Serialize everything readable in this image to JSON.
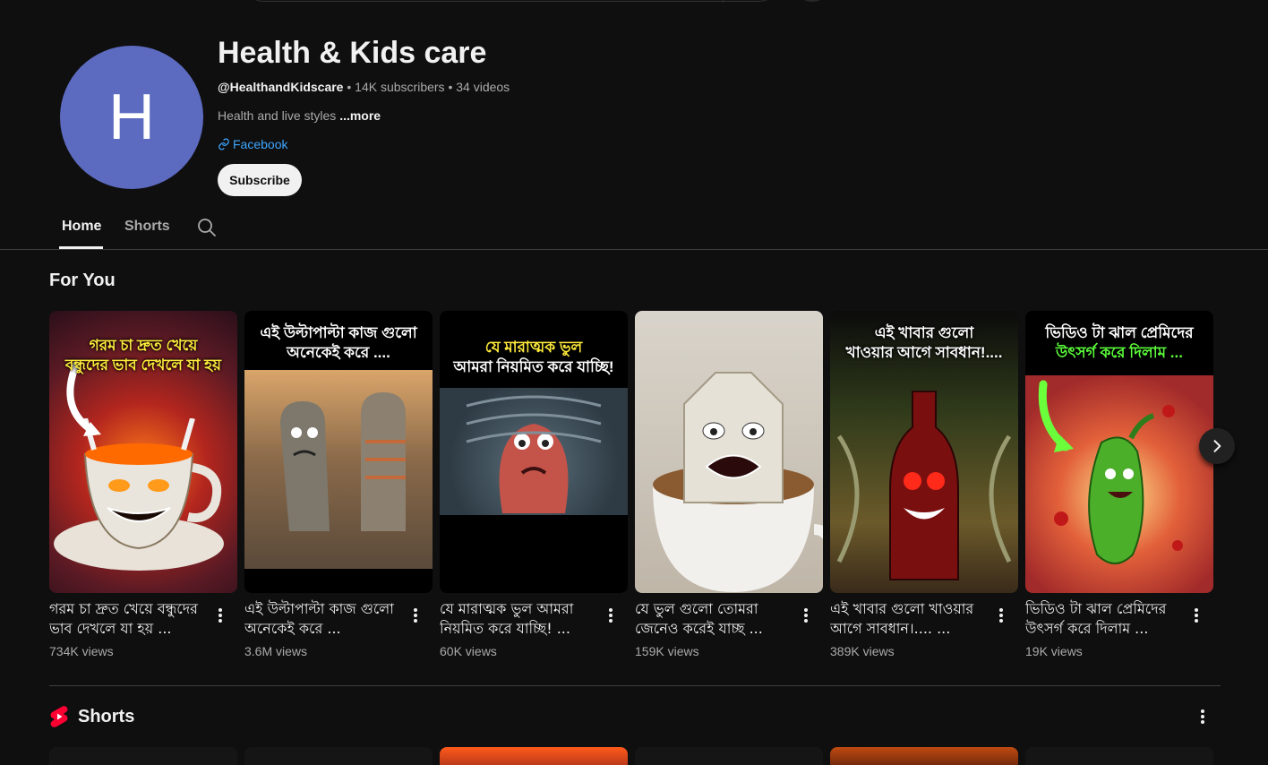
{
  "channel": {
    "avatar_letter": "H",
    "avatar_color": "#5c6bc0",
    "title": "Health & Kids care",
    "handle": "@HealthandKidscare",
    "meta_sep": " • ",
    "subscribers": "14K subscribers",
    "videos": "34 videos",
    "description": "Health and live styles ",
    "more": "...more",
    "link_icon": "link-icon",
    "link_label": "Facebook",
    "subscribe_label": "Subscribe"
  },
  "tabs": [
    {
      "label": "Home",
      "active": true
    },
    {
      "label": "Shorts",
      "active": false
    }
  ],
  "section_title": "For You",
  "videos": [
    {
      "caption_lines": [
        "গরম চা দ্রুত খেয়ে",
        "বন্ধুদের ভাব দেখলে যা হয়"
      ],
      "title": "গরম চা দ্রুত খেয়ে বন্ধুদের ভাব দেখলে যা হয় ...",
      "views": "734K views"
    },
    {
      "caption_lines": [
        "এই উল্টাপাল্টা কাজ গুলো",
        "অনেকেই করে ...."
      ],
      "title": "এই উল্টাপাল্টা কাজ গুলো অনেকেই করে ...",
      "views": "3.6M views"
    },
    {
      "caption_lines": [
        "যে মারাত্মক ভুল",
        "আমরা নিয়মিত করে যাচ্ছি!"
      ],
      "title": "যে মারাত্মক ভুল আমরা নিয়মিত করে যাচ্ছি! ...",
      "views": "60K views"
    },
    {
      "caption_lines": [],
      "title": "যে ভুল গুলো তোমরা জেনেও করেই যাচ্ছ ...",
      "views": "159K views"
    },
    {
      "caption_lines": [
        "এই খাবার গুলো",
        "খাওয়ার আগে সাবধান!...."
      ],
      "title": "এই খাবার গুলো খাওয়ার আগে সাবধান।.... ...",
      "views": "389K views"
    },
    {
      "caption_lines": [
        "ভিডিও টা ঝাল প্রেমিদের",
        "উৎসর্গ করে দিলাম ..."
      ],
      "title": "ভিডিও টা ঝাল প্রেমিদের উৎসর্গ করে দিলাম ...",
      "views": "19K views"
    }
  ],
  "shorts_title": "Shorts",
  "colors": {
    "background": "#0f0f0f",
    "text": "#f1f1f1",
    "secondary_text": "#aaaaaa",
    "link": "#3ea6ff",
    "shorts_red": "#ff0033"
  }
}
